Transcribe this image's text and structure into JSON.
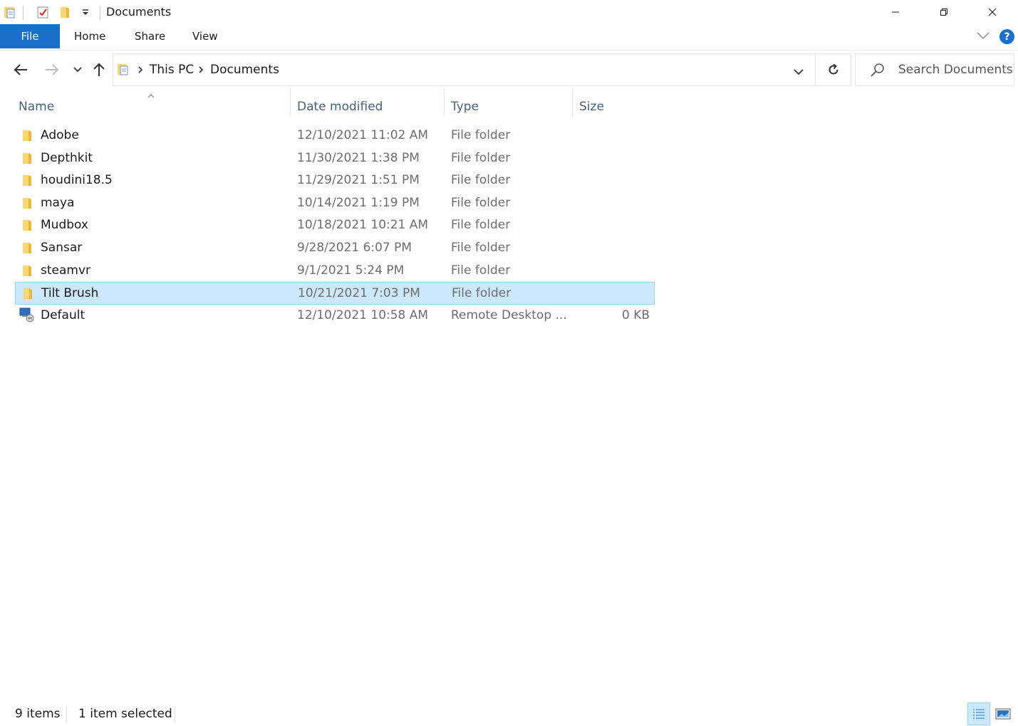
{
  "window": {
    "title": "Documents",
    "minimize_icon": "minimize-icon",
    "restore_icon": "restore-icon",
    "close_icon": "close-icon"
  },
  "ribbon": {
    "tabs": [
      {
        "label": "File"
      },
      {
        "label": "Home"
      },
      {
        "label": "Share"
      },
      {
        "label": "View"
      }
    ],
    "help_label": "?"
  },
  "address": {
    "crumbs": [
      "This PC",
      "Documents"
    ]
  },
  "search": {
    "placeholder": "Search Documents"
  },
  "columns": {
    "name": "Name",
    "date": "Date modified",
    "type": "Type",
    "size": "Size"
  },
  "files": [
    {
      "name": "Adobe",
      "date": "12/10/2021 11:02 AM",
      "type": "File folder",
      "size": "",
      "icon": "folder-icon"
    },
    {
      "name": "Depthkit",
      "date": "11/30/2021 1:38 PM",
      "type": "File folder",
      "size": "",
      "icon": "folder-icon"
    },
    {
      "name": "houdini18.5",
      "date": "11/29/2021 1:51 PM",
      "type": "File folder",
      "size": "",
      "icon": "folder-icon"
    },
    {
      "name": "maya",
      "date": "10/14/2021 1:19 PM",
      "type": "File folder",
      "size": "",
      "icon": "folder-icon"
    },
    {
      "name": "Mudbox",
      "date": "10/18/2021 10:21 AM",
      "type": "File folder",
      "size": "",
      "icon": "folder-icon"
    },
    {
      "name": "Sansar",
      "date": "9/28/2021 6:07 PM",
      "type": "File folder",
      "size": "",
      "icon": "folder-icon"
    },
    {
      "name": "steamvr",
      "date": "9/1/2021 5:24 PM",
      "type": "File folder",
      "size": "",
      "icon": "folder-icon"
    },
    {
      "name": "Tilt Brush",
      "date": "10/21/2021 7:03 PM",
      "type": "File folder",
      "size": "",
      "icon": "folder-icon",
      "selected": true
    },
    {
      "name": "Default",
      "date": "12/10/2021 10:58 AM",
      "type": "Remote Desktop ...",
      "size": "0 KB",
      "icon": "remote-desktop-icon"
    }
  ],
  "status": {
    "count": "9 items",
    "selection": "1 item selected"
  },
  "colors": {
    "accent": "#1a6fc9",
    "selection": "#cce8ff",
    "folder": "#f8d775"
  }
}
